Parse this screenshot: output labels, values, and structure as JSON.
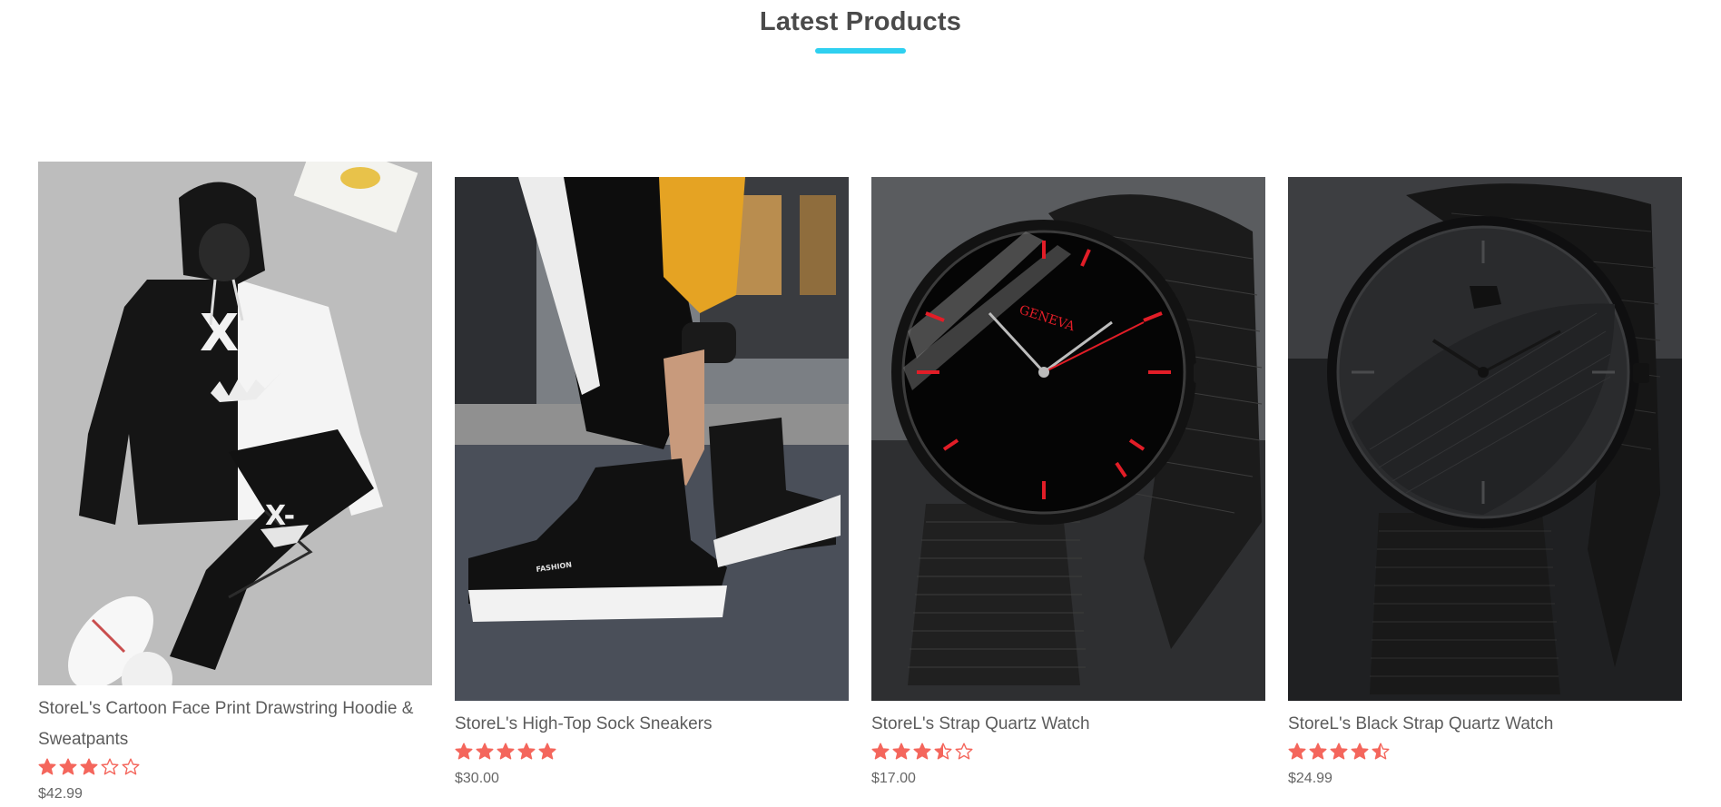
{
  "section": {
    "title": "Latest Products",
    "accent_color": "#2fd0f0"
  },
  "rating_color": "#f4665c",
  "products": [
    {
      "name": "StoreL's Cartoon Face Print Drawstring Hoodie & Sweatpants",
      "rating": 3,
      "max_rating": 5,
      "price": "$42.99",
      "image": "hoodie-sweatpants-set"
    },
    {
      "name": "StoreL's High-Top Sock Sneakers",
      "rating": 5,
      "max_rating": 5,
      "price": "$30.00",
      "image": "sock-sneakers",
      "image_text": "FASHION"
    },
    {
      "name": "StoreL's Strap Quartz Watch",
      "rating": 3.5,
      "max_rating": 5,
      "price": "$17.00",
      "image": "red-mesh-watch",
      "image_text": "GENEVA"
    },
    {
      "name": "StoreL's Black Strap Quartz Watch",
      "rating": 4.5,
      "max_rating": 5,
      "price": "$24.99",
      "image": "black-mesh-watch"
    }
  ]
}
